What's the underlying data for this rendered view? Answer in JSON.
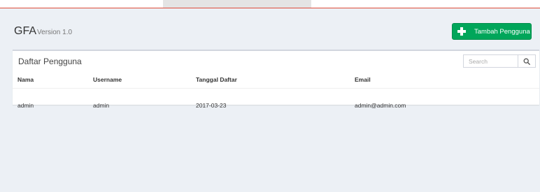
{
  "app": {
    "name": "GFA",
    "version": "Version 1.0"
  },
  "header": {
    "add_button_label": "Tambah Pengguna"
  },
  "panel": {
    "title": "Daftar Pengguna",
    "search": {
      "placeholder": "Search",
      "value": ""
    }
  },
  "table": {
    "columns": [
      "Nama",
      "Username",
      "Tanggal Daftar",
      "Email"
    ],
    "rows": [
      [
        "admin",
        "admin",
        "2017-03-23",
        "admin@admin.com"
      ]
    ]
  },
  "colors": {
    "accent_line": "#dd4b39",
    "button_green": "#00a65a",
    "background": "#ecf0f5"
  },
  "icons": [
    "plus-icon",
    "search-icon"
  ]
}
